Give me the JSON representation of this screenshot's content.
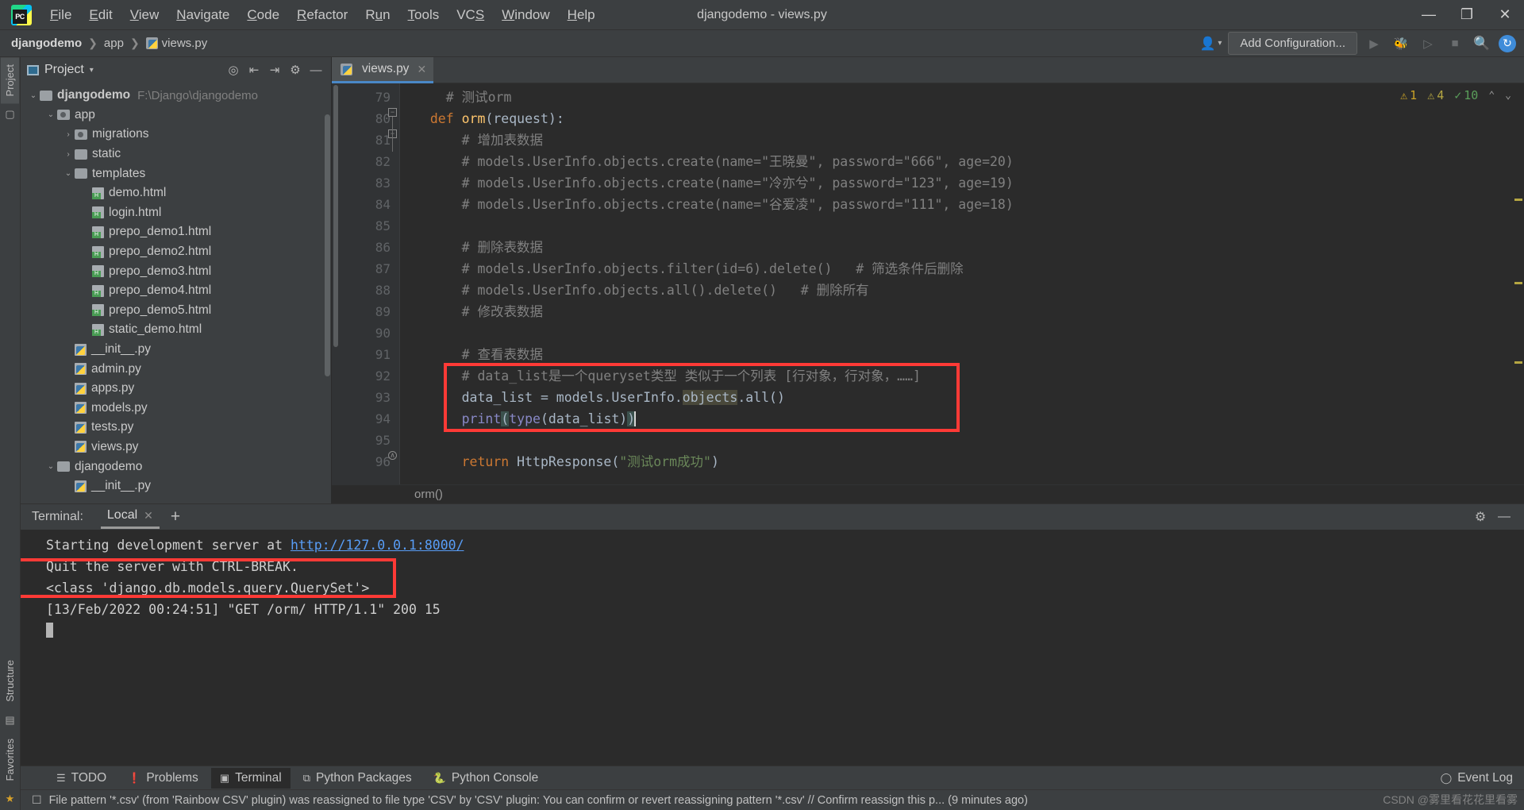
{
  "window": {
    "title": "djangodemo - views.py",
    "logo_text": "PC",
    "minimize": "—",
    "maximize": "❐",
    "close": "✕"
  },
  "menu": [
    {
      "label": "File"
    },
    {
      "label": "Edit"
    },
    {
      "label": "View"
    },
    {
      "label": "Navigate"
    },
    {
      "label": "Code"
    },
    {
      "label": "Refactor"
    },
    {
      "label": "Run"
    },
    {
      "label": "Tools"
    },
    {
      "label": "VCS"
    },
    {
      "label": "Window"
    },
    {
      "label": "Help"
    }
  ],
  "navbar": {
    "breadcrumb": [
      "djangodemo",
      "app",
      "views.py"
    ],
    "separator": "❯",
    "add_configuration": "Add Configuration...",
    "user_icon": "user-icon",
    "run_icon": "run-icon",
    "debug_icon": "debug-icon",
    "coverage_icon": "coverage-icon",
    "stop_icon": "stop-icon",
    "search_icon": "search-icon",
    "updates_icon": "updates-icon"
  },
  "left_strip": {
    "project_tab": "Project",
    "structure_tab": "Structure",
    "favorites_tab": "Favorites",
    "icons": [
      "bookmark-icon",
      "star-icon",
      "terminal-icon"
    ]
  },
  "project_panel": {
    "title": "Project",
    "tools": [
      "locate-icon",
      "expand-all-icon",
      "collapse-all-icon",
      "gear-icon",
      "hide-icon"
    ],
    "tree": [
      {
        "indent": 0,
        "arrow": "⌄",
        "icon": "folder",
        "label": "djangodemo",
        "bold": true,
        "path": "F:\\Django\\djangodemo"
      },
      {
        "indent": 1,
        "arrow": "⌄",
        "icon": "folder-src",
        "label": "app",
        "bold": false,
        "path": ""
      },
      {
        "indent": 2,
        "arrow": "›",
        "icon": "folder-src",
        "label": "migrations",
        "bold": false,
        "path": ""
      },
      {
        "indent": 2,
        "arrow": "›",
        "icon": "folder",
        "label": "static",
        "bold": false,
        "path": ""
      },
      {
        "indent": 2,
        "arrow": "⌄",
        "icon": "folder",
        "label": "templates",
        "bold": false,
        "path": ""
      },
      {
        "indent": 3,
        "arrow": "",
        "icon": "html",
        "label": "demo.html",
        "bold": false,
        "path": ""
      },
      {
        "indent": 3,
        "arrow": "",
        "icon": "html",
        "label": "login.html",
        "bold": false,
        "path": ""
      },
      {
        "indent": 3,
        "arrow": "",
        "icon": "html",
        "label": "prepo_demo1.html",
        "bold": false,
        "path": ""
      },
      {
        "indent": 3,
        "arrow": "",
        "icon": "html",
        "label": "prepo_demo2.html",
        "bold": false,
        "path": ""
      },
      {
        "indent": 3,
        "arrow": "",
        "icon": "html",
        "label": "prepo_demo3.html",
        "bold": false,
        "path": ""
      },
      {
        "indent": 3,
        "arrow": "",
        "icon": "html",
        "label": "prepo_demo4.html",
        "bold": false,
        "path": ""
      },
      {
        "indent": 3,
        "arrow": "",
        "icon": "html",
        "label": "prepo_demo5.html",
        "bold": false,
        "path": ""
      },
      {
        "indent": 3,
        "arrow": "",
        "icon": "html",
        "label": "static_demo.html",
        "bold": false,
        "path": ""
      },
      {
        "indent": 2,
        "arrow": "",
        "icon": "py",
        "label": "__init__.py",
        "bold": false,
        "path": ""
      },
      {
        "indent": 2,
        "arrow": "",
        "icon": "py",
        "label": "admin.py",
        "bold": false,
        "path": ""
      },
      {
        "indent": 2,
        "arrow": "",
        "icon": "py",
        "label": "apps.py",
        "bold": false,
        "path": ""
      },
      {
        "indent": 2,
        "arrow": "",
        "icon": "py",
        "label": "models.py",
        "bold": false,
        "path": ""
      },
      {
        "indent": 2,
        "arrow": "",
        "icon": "py",
        "label": "tests.py",
        "bold": false,
        "path": ""
      },
      {
        "indent": 2,
        "arrow": "",
        "icon": "py",
        "label": "views.py",
        "bold": false,
        "path": ""
      },
      {
        "indent": 1,
        "arrow": "⌄",
        "icon": "folder",
        "label": "djangodemo",
        "bold": false,
        "path": ""
      },
      {
        "indent": 2,
        "arrow": "",
        "icon": "py",
        "label": "__init__.py",
        "bold": false,
        "path": ""
      }
    ]
  },
  "editor": {
    "tab": {
      "label": "views.py",
      "icon": "python-file-icon",
      "close": "✕"
    },
    "inspections": {
      "warning_count": "1",
      "weak_warning_count": "4",
      "ok_count": "10",
      "up": "⌃",
      "down": "⌄"
    },
    "breadcrumb_bottom": "orm()",
    "first_line": 79,
    "lines": [
      {
        "n": 79,
        "segs": [
          {
            "t": "    # 测试orm",
            "c": "cmt"
          }
        ]
      },
      {
        "n": 80,
        "segs": [
          {
            "t": "  ",
            "c": ""
          },
          {
            "t": "def ",
            "c": "kw"
          },
          {
            "t": "orm",
            "c": "fn"
          },
          {
            "t": "(request):",
            "c": ""
          }
        ]
      },
      {
        "n": 81,
        "segs": [
          {
            "t": "      # 增加表数据",
            "c": "cmt"
          }
        ]
      },
      {
        "n": 82,
        "segs": [
          {
            "t": "      # models.UserInfo.objects.create(name=\"王晓曼\", password=\"666\", age=20)",
            "c": "cmt"
          }
        ]
      },
      {
        "n": 83,
        "segs": [
          {
            "t": "      # models.UserInfo.objects.create(name=\"冷亦兮\", password=\"123\", age=19)",
            "c": "cmt"
          }
        ]
      },
      {
        "n": 84,
        "segs": [
          {
            "t": "      # models.UserInfo.objects.create(name=\"谷爱凌\", password=\"111\", age=18)",
            "c": "cmt"
          }
        ]
      },
      {
        "n": 85,
        "segs": [
          {
            "t": "",
            "c": ""
          }
        ]
      },
      {
        "n": 86,
        "segs": [
          {
            "t": "      # 删除表数据",
            "c": "cmt"
          }
        ]
      },
      {
        "n": 87,
        "segs": [
          {
            "t": "      # models.UserInfo.objects.filter(id=6).delete()   # 筛选条件后删除",
            "c": "cmt"
          }
        ]
      },
      {
        "n": 88,
        "segs": [
          {
            "t": "      # models.UserInfo.objects.all().delete()   # 删除所有",
            "c": "cmt"
          }
        ]
      },
      {
        "n": 89,
        "segs": [
          {
            "t": "      # 修改表数据",
            "c": "cmt"
          }
        ]
      },
      {
        "n": 90,
        "segs": [
          {
            "t": "",
            "c": ""
          }
        ]
      },
      {
        "n": 91,
        "segs": [
          {
            "t": "      # 查看表数据",
            "c": "cmt"
          }
        ]
      },
      {
        "n": 92,
        "segs": [
          {
            "t": "      # data_list是一个queryset类型 类似于一个列表 [行对象，行对象，……]",
            "c": "cmt"
          }
        ]
      },
      {
        "n": 93,
        "segs": [
          {
            "t": "      data_list = models.UserInfo.",
            "c": ""
          },
          {
            "t": "objects",
            "c": "hl-objects"
          },
          {
            "t": ".all()",
            "c": ""
          }
        ]
      },
      {
        "n": 94,
        "segs": [
          {
            "t": "      ",
            "c": ""
          },
          {
            "t": "print",
            "c": "bi"
          },
          {
            "t": "(",
            "c": "paren-hl"
          },
          {
            "t": "type",
            "c": "bi"
          },
          {
            "t": "(data_list)",
            "c": ""
          },
          {
            "t": ")",
            "c": "paren-hl"
          }
        ]
      },
      {
        "n": 95,
        "segs": [
          {
            "t": "",
            "c": ""
          }
        ]
      },
      {
        "n": 96,
        "segs": [
          {
            "t": "      ",
            "c": ""
          },
          {
            "t": "return ",
            "c": "kw"
          },
          {
            "t": "HttpResponse(",
            "c": ""
          },
          {
            "t": "\"测试orm成功\"",
            "c": "str"
          },
          {
            "t": ")",
            "c": ""
          }
        ]
      }
    ]
  },
  "terminal": {
    "label": "Terminal:",
    "tab": "Local",
    "tab_close": "✕",
    "add": "+",
    "settings_icon": "gear-icon",
    "hide_icon": "hide-icon",
    "lines": [
      {
        "pre": "Starting development server at ",
        "link": "http://127.0.0.1:8000/",
        "post": ""
      },
      {
        "pre": "Quit the server with CTRL-BREAK.",
        "link": "",
        "post": ""
      },
      {
        "pre": "<class 'django.db.models.query.QuerySet'>",
        "link": "",
        "post": ""
      },
      {
        "pre": "[13/Feb/2022 00:24:51] \"GET /orm/ HTTP/1.1\" 200 15",
        "link": "",
        "post": ""
      }
    ]
  },
  "bottom_tools": [
    {
      "label": "TODO",
      "icon": "list-icon",
      "active": false
    },
    {
      "label": "Problems",
      "icon": "problems-icon",
      "active": false
    },
    {
      "label": "Terminal",
      "icon": "terminal-icon",
      "active": true
    },
    {
      "label": "Python Packages",
      "icon": "packages-icon",
      "active": false
    },
    {
      "label": "Python Console",
      "icon": "python-icon",
      "active": false
    }
  ],
  "event_log": {
    "label": "Event Log",
    "icon": "balloon-icon"
  },
  "status_bar": {
    "icon": "notification-icon",
    "message": "File pattern '*.csv' (from 'Rainbow CSV' plugin) was reassigned to file type 'CSV' by 'CSV' plugin: You can confirm or revert reassigning pattern '*.csv' // Confirm reassign this p... (9 minutes ago)",
    "watermark": "CSDN @雾里看花花里看雾"
  },
  "colors": {
    "accent": "#4a88c7",
    "highlight_box": "#ff3a36",
    "link": "#589df6",
    "comment": "#808080",
    "keyword": "#cc7832",
    "string": "#6a8759",
    "function": "#ffc66d"
  }
}
